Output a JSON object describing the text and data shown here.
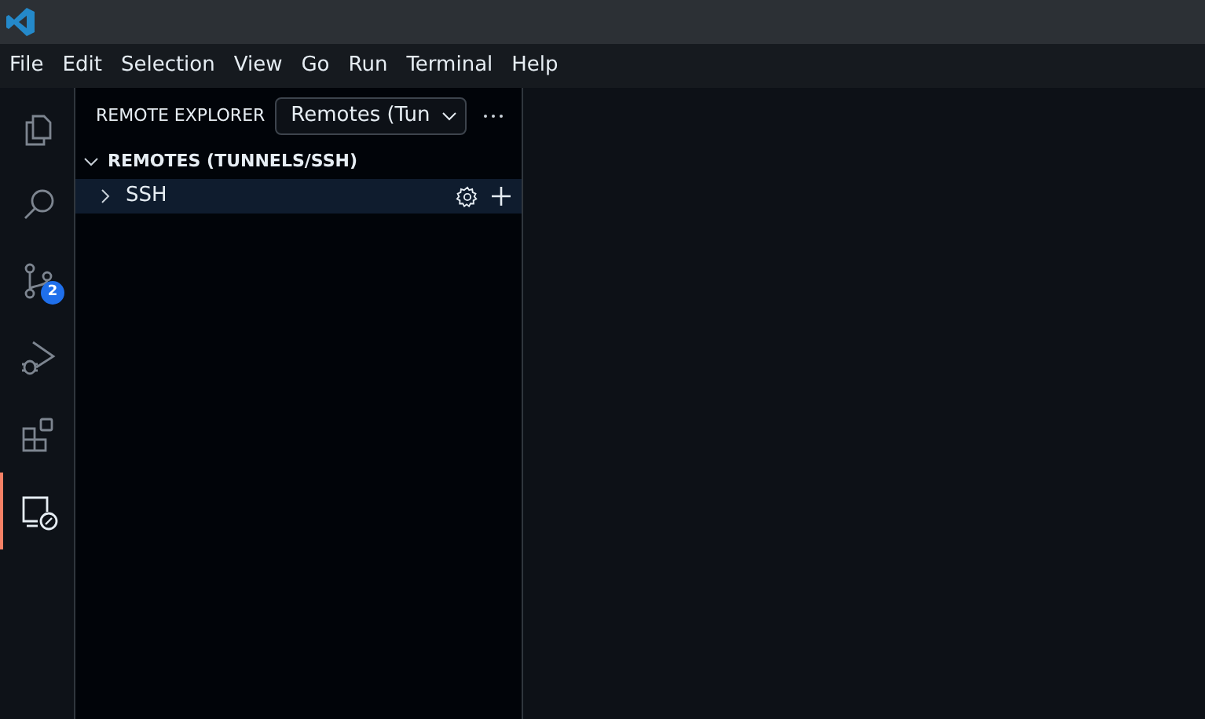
{
  "menu": [
    "File",
    "Edit",
    "Selection",
    "View",
    "Go",
    "Run",
    "Terminal",
    "Help"
  ],
  "activity_bar": [
    {
      "kind": "files",
      "selected": false
    },
    {
      "kind": "search",
      "selected": false
    },
    {
      "kind": "source-control",
      "selected": false,
      "badge": "2"
    },
    {
      "kind": "run-debug",
      "selected": false
    },
    {
      "kind": "extensions",
      "selected": false
    },
    {
      "kind": "remote",
      "selected": true
    }
  ],
  "sidebar": {
    "title": "REMOTE EXPLORER",
    "dropdown": "Remotes (Tun",
    "section": {
      "title": "REMOTES (TUNNELS/SSH)",
      "expanded": true,
      "items": [
        {
          "label": "SSH",
          "expanded": false,
          "selected": true
        }
      ]
    }
  }
}
